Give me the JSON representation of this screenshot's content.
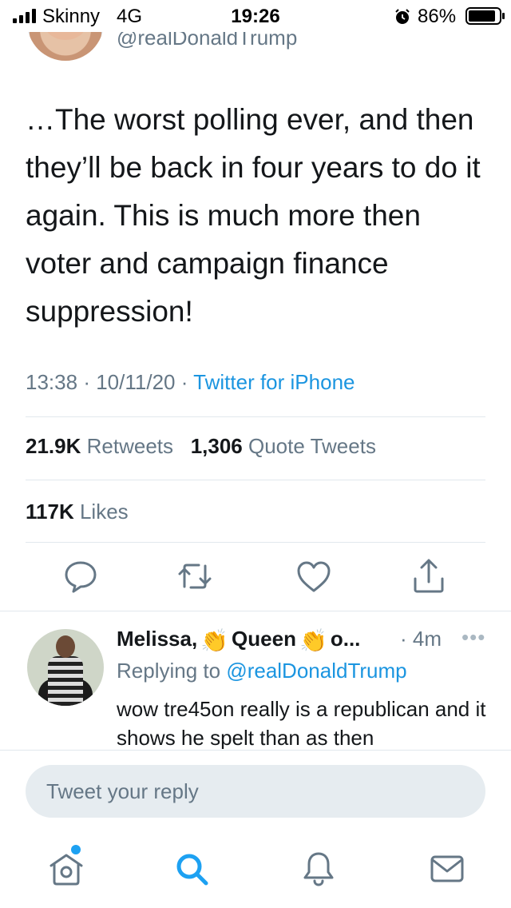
{
  "status_bar": {
    "carrier": "Skinny",
    "network": "4G",
    "time": "19:26",
    "battery": "86%"
  },
  "tweet": {
    "handle": "@realDonaldTrump",
    "text": "…The worst polling ever, and then they’ll be back in four years to do it again. This is much more then voter and campaign finance suppression!",
    "time": "13:38",
    "date": "10/11/20",
    "separator": "·",
    "source": "Twitter for iPhone",
    "retweets_count": "21.9K",
    "retweets_label": "Retweets",
    "quotes_count": "1,306",
    "quotes_label": "Quote Tweets",
    "likes_count": "117K",
    "likes_label": "Likes"
  },
  "actions": {
    "icons": [
      "reply-icon",
      "retweet-icon",
      "like-icon",
      "share-icon"
    ]
  },
  "reply": {
    "name_part1": "Melissa,",
    "name_part2": "Queen",
    "name_part3": "o...",
    "emoji": "👏",
    "time": "· 4m",
    "more": "•••",
    "replying_prefix": "Replying to",
    "replying_to": "@realDonaldTrump",
    "text": "wow tre45on really is a republican and it shows he spelt than as then"
  },
  "compose": {
    "placeholder": "Tweet your reply"
  },
  "tab_bar": {
    "items": [
      "home-icon",
      "search-icon",
      "notifications-icon",
      "messages-icon"
    ]
  },
  "colors": {
    "accent": "#1da1f2",
    "link": "#1b95e0",
    "secondary_text": "#657786",
    "primary_text": "#14171a",
    "divider": "#e1e8ed"
  }
}
